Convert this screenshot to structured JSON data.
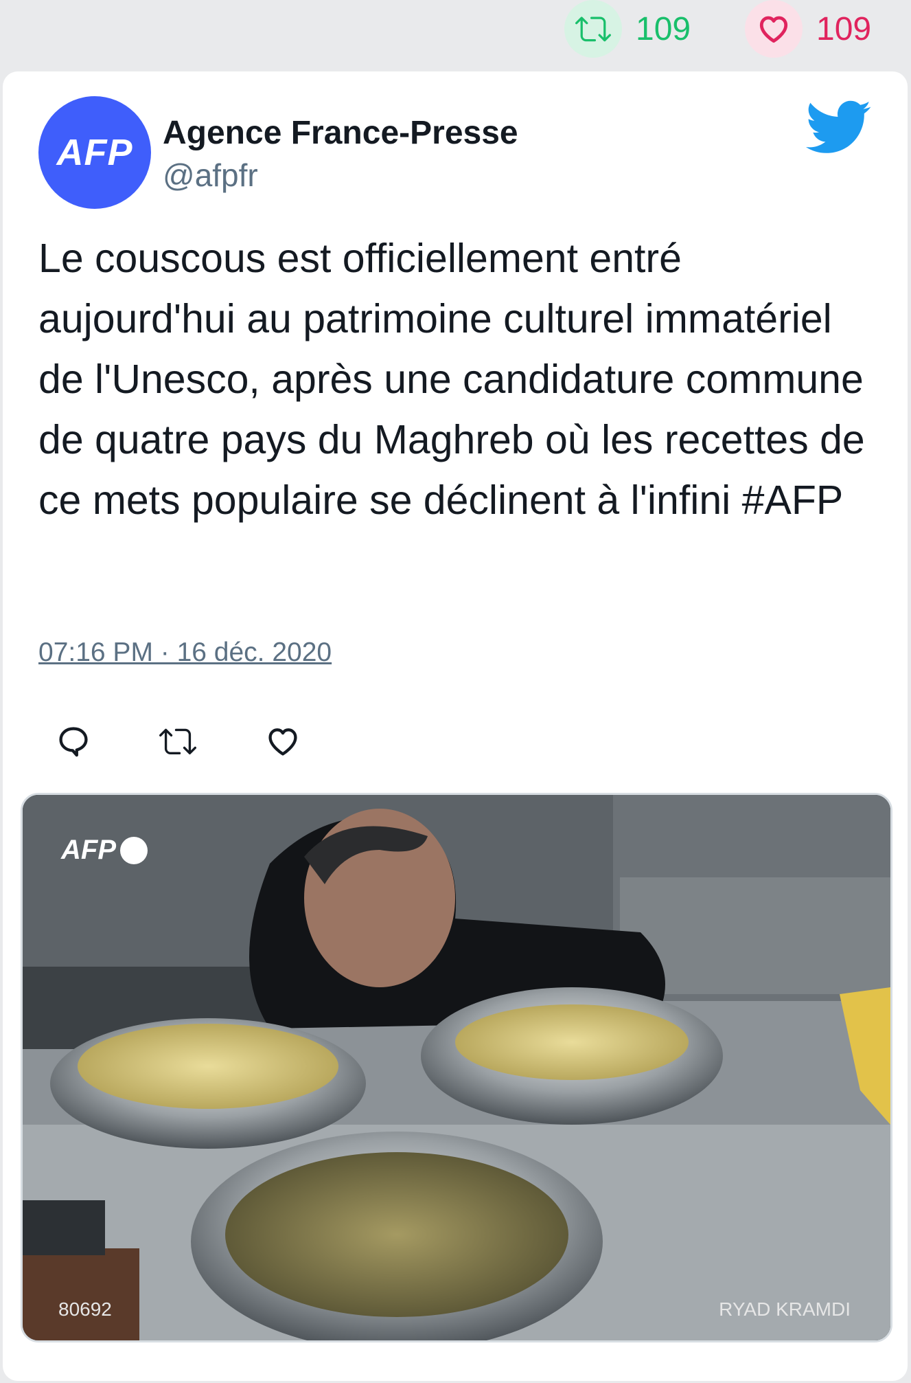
{
  "top_bar": {
    "retweet_count": "109",
    "like_count": "109",
    "retweet_color": "#19bf6b",
    "like_color": "#e0245e"
  },
  "tweet": {
    "avatar_text": "AFP",
    "author_name": "Agence France-Presse",
    "author_handle": "@afpfr",
    "text": "Le couscous est officiellement entré aujourd'hui au patrimoine culturel immatériel de l'Unesco, après une candidature commune de quatre pays du Maghreb où les recettes de ce mets populaire se déclinent à l'infini #AFP",
    "timestamp": "07:16 PM · 16 déc. 2020",
    "brand_icon": "twitter-bird-icon",
    "brand_color": "#1d9bf0",
    "actions": [
      "reply-icon",
      "retweet-icon",
      "like-icon"
    ]
  },
  "media": {
    "logo_text": "AFP",
    "image_id": "80692",
    "photo_credit": "RYAD KRAMDI"
  }
}
